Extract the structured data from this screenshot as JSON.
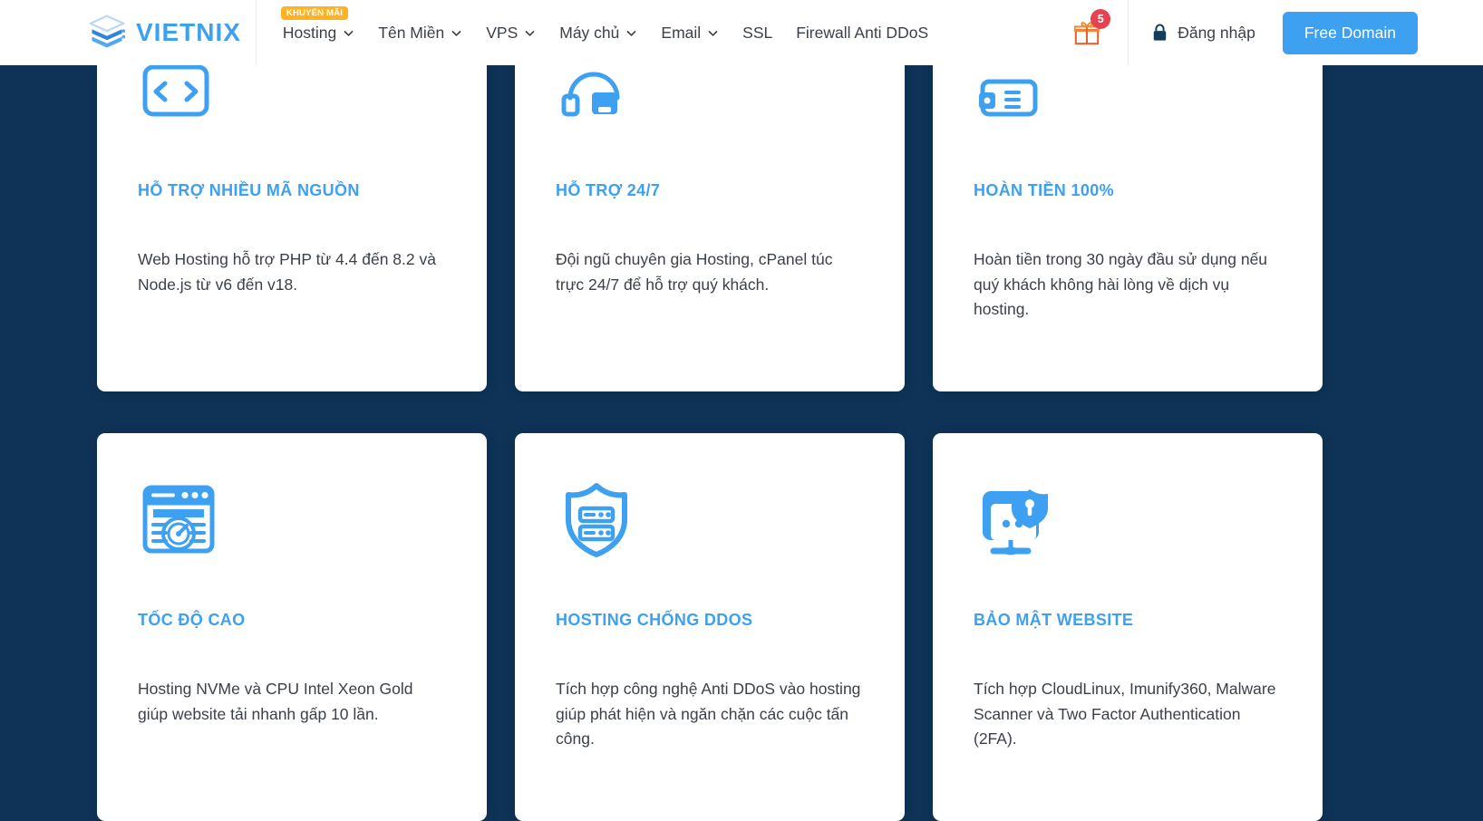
{
  "brand": {
    "name": "VIETNIX",
    "logo_icon": "stacked-layers-logo",
    "color": "#3da0f0"
  },
  "header": {
    "promo_badge": "KHUYẾN MÃI",
    "nav": [
      {
        "label": "Hosting",
        "has_dropdown": true,
        "badge": "KHUYẾN MÃI"
      },
      {
        "label": "Tên Miền",
        "has_dropdown": true,
        "badge": ""
      },
      {
        "label": "VPS",
        "has_dropdown": true,
        "badge": ""
      },
      {
        "label": "Máy chủ",
        "has_dropdown": true,
        "badge": ""
      },
      {
        "label": "Email",
        "has_dropdown": true,
        "badge": ""
      },
      {
        "label": "SSL",
        "has_dropdown": false,
        "badge": ""
      },
      {
        "label": "Firewall Anti DDoS",
        "has_dropdown": false,
        "badge": ""
      }
    ],
    "gift": {
      "icon": "gift-icon",
      "count": "5",
      "badge_color": "#e8414f"
    },
    "login": {
      "icon": "lock-icon",
      "label": "Đăng nhập"
    },
    "cta": {
      "label": "Free Domain",
      "color": "#3da0f0"
    }
  },
  "features": [
    {
      "icon": "source-code-icon",
      "title": "HỖ TRỢ NHIỀU MÃ NGUỒN",
      "desc": "Web Hosting hỗ trợ PHP từ 4.4 đến 8.2 và Node.js từ v6 đến v18."
    },
    {
      "icon": "headset-support-icon",
      "title": "HỖ TRỢ 24/7",
      "desc": "Đội ngũ chuyên gia Hosting, cPanel túc trực 24/7 để hỗ trợ quý khách."
    },
    {
      "icon": "money-back-icon",
      "title": "HOÀN TIỀN 100%",
      "desc": "Hoàn tiền trong 30 ngày đầu sử dụng nếu quý khách không hài lòng về dịch vụ hosting."
    },
    {
      "icon": "speedometer-browser-icon",
      "title": "TỐC ĐỘ CAO",
      "desc": "Hosting NVMe và CPU Intel Xeon Gold giúp website tải nhanh gấp 10 lần."
    },
    {
      "icon": "shield-server-icon",
      "title": "HOSTING CHỐNG DDOS",
      "desc": "Tích hợp công nghệ Anti DDoS vào hosting giúp phát hiện và ngăn chặn các cuộc tấn công."
    },
    {
      "icon": "monitor-lock-icon",
      "title": "BẢO MẬT WEBSITE",
      "desc": "Tích hợp CloudLinux, Imunify360, Malware Scanner và Two Factor Authentication (2FA)."
    }
  ],
  "theme": {
    "page_background": "#0e3356",
    "card_background": "#ffffff",
    "accent": "#3da0f0",
    "text": "#3c4149",
    "promo_badge_color": "#ffb224"
  }
}
